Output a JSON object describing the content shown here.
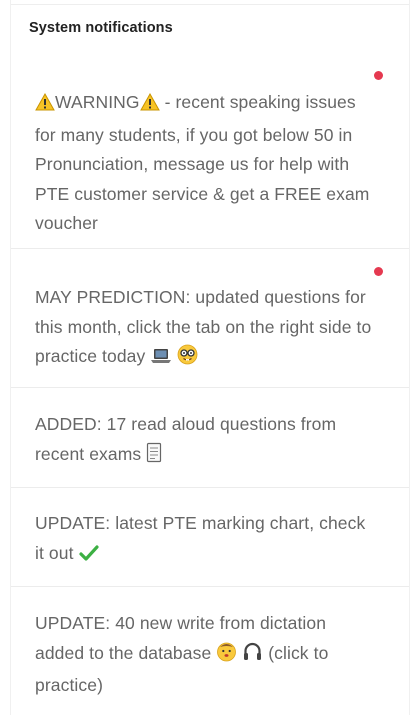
{
  "panel": {
    "title": "System notifications"
  },
  "notifications": [
    {
      "unread": true,
      "warning_word": "WARNING",
      "text": " - recent speaking issues for many students, if you got below 50 in Pronunciation, message us for help with PTE customer service & get a FREE exam voucher",
      "icons": [
        "warning-icon",
        "warning-icon"
      ]
    },
    {
      "unread": true,
      "text": "MAY PREDICTION: updated questions for this month, click the tab on the right side to practice today",
      "icons": [
        "laptop-icon",
        "nerd-face-icon"
      ]
    },
    {
      "unread": false,
      "text": "ADDED: 17 read aloud questions from recent exams",
      "icons": [
        "memo-icon"
      ]
    },
    {
      "unread": false,
      "text": "UPDATE: latest PTE marking chart, check it out",
      "icons": [
        "check-mark-icon"
      ]
    },
    {
      "unread": false,
      "text_before": "UPDATE: 40 new write from dictation added to the database",
      "text_after": "(click to practice)",
      "icons": [
        "baby-face-icon",
        "headphone-icon"
      ]
    }
  ],
  "colors": {
    "unread_dot": "#e53950",
    "text": "#666666",
    "title": "#222222",
    "divider": "#ececec",
    "check": "#3cb043"
  }
}
